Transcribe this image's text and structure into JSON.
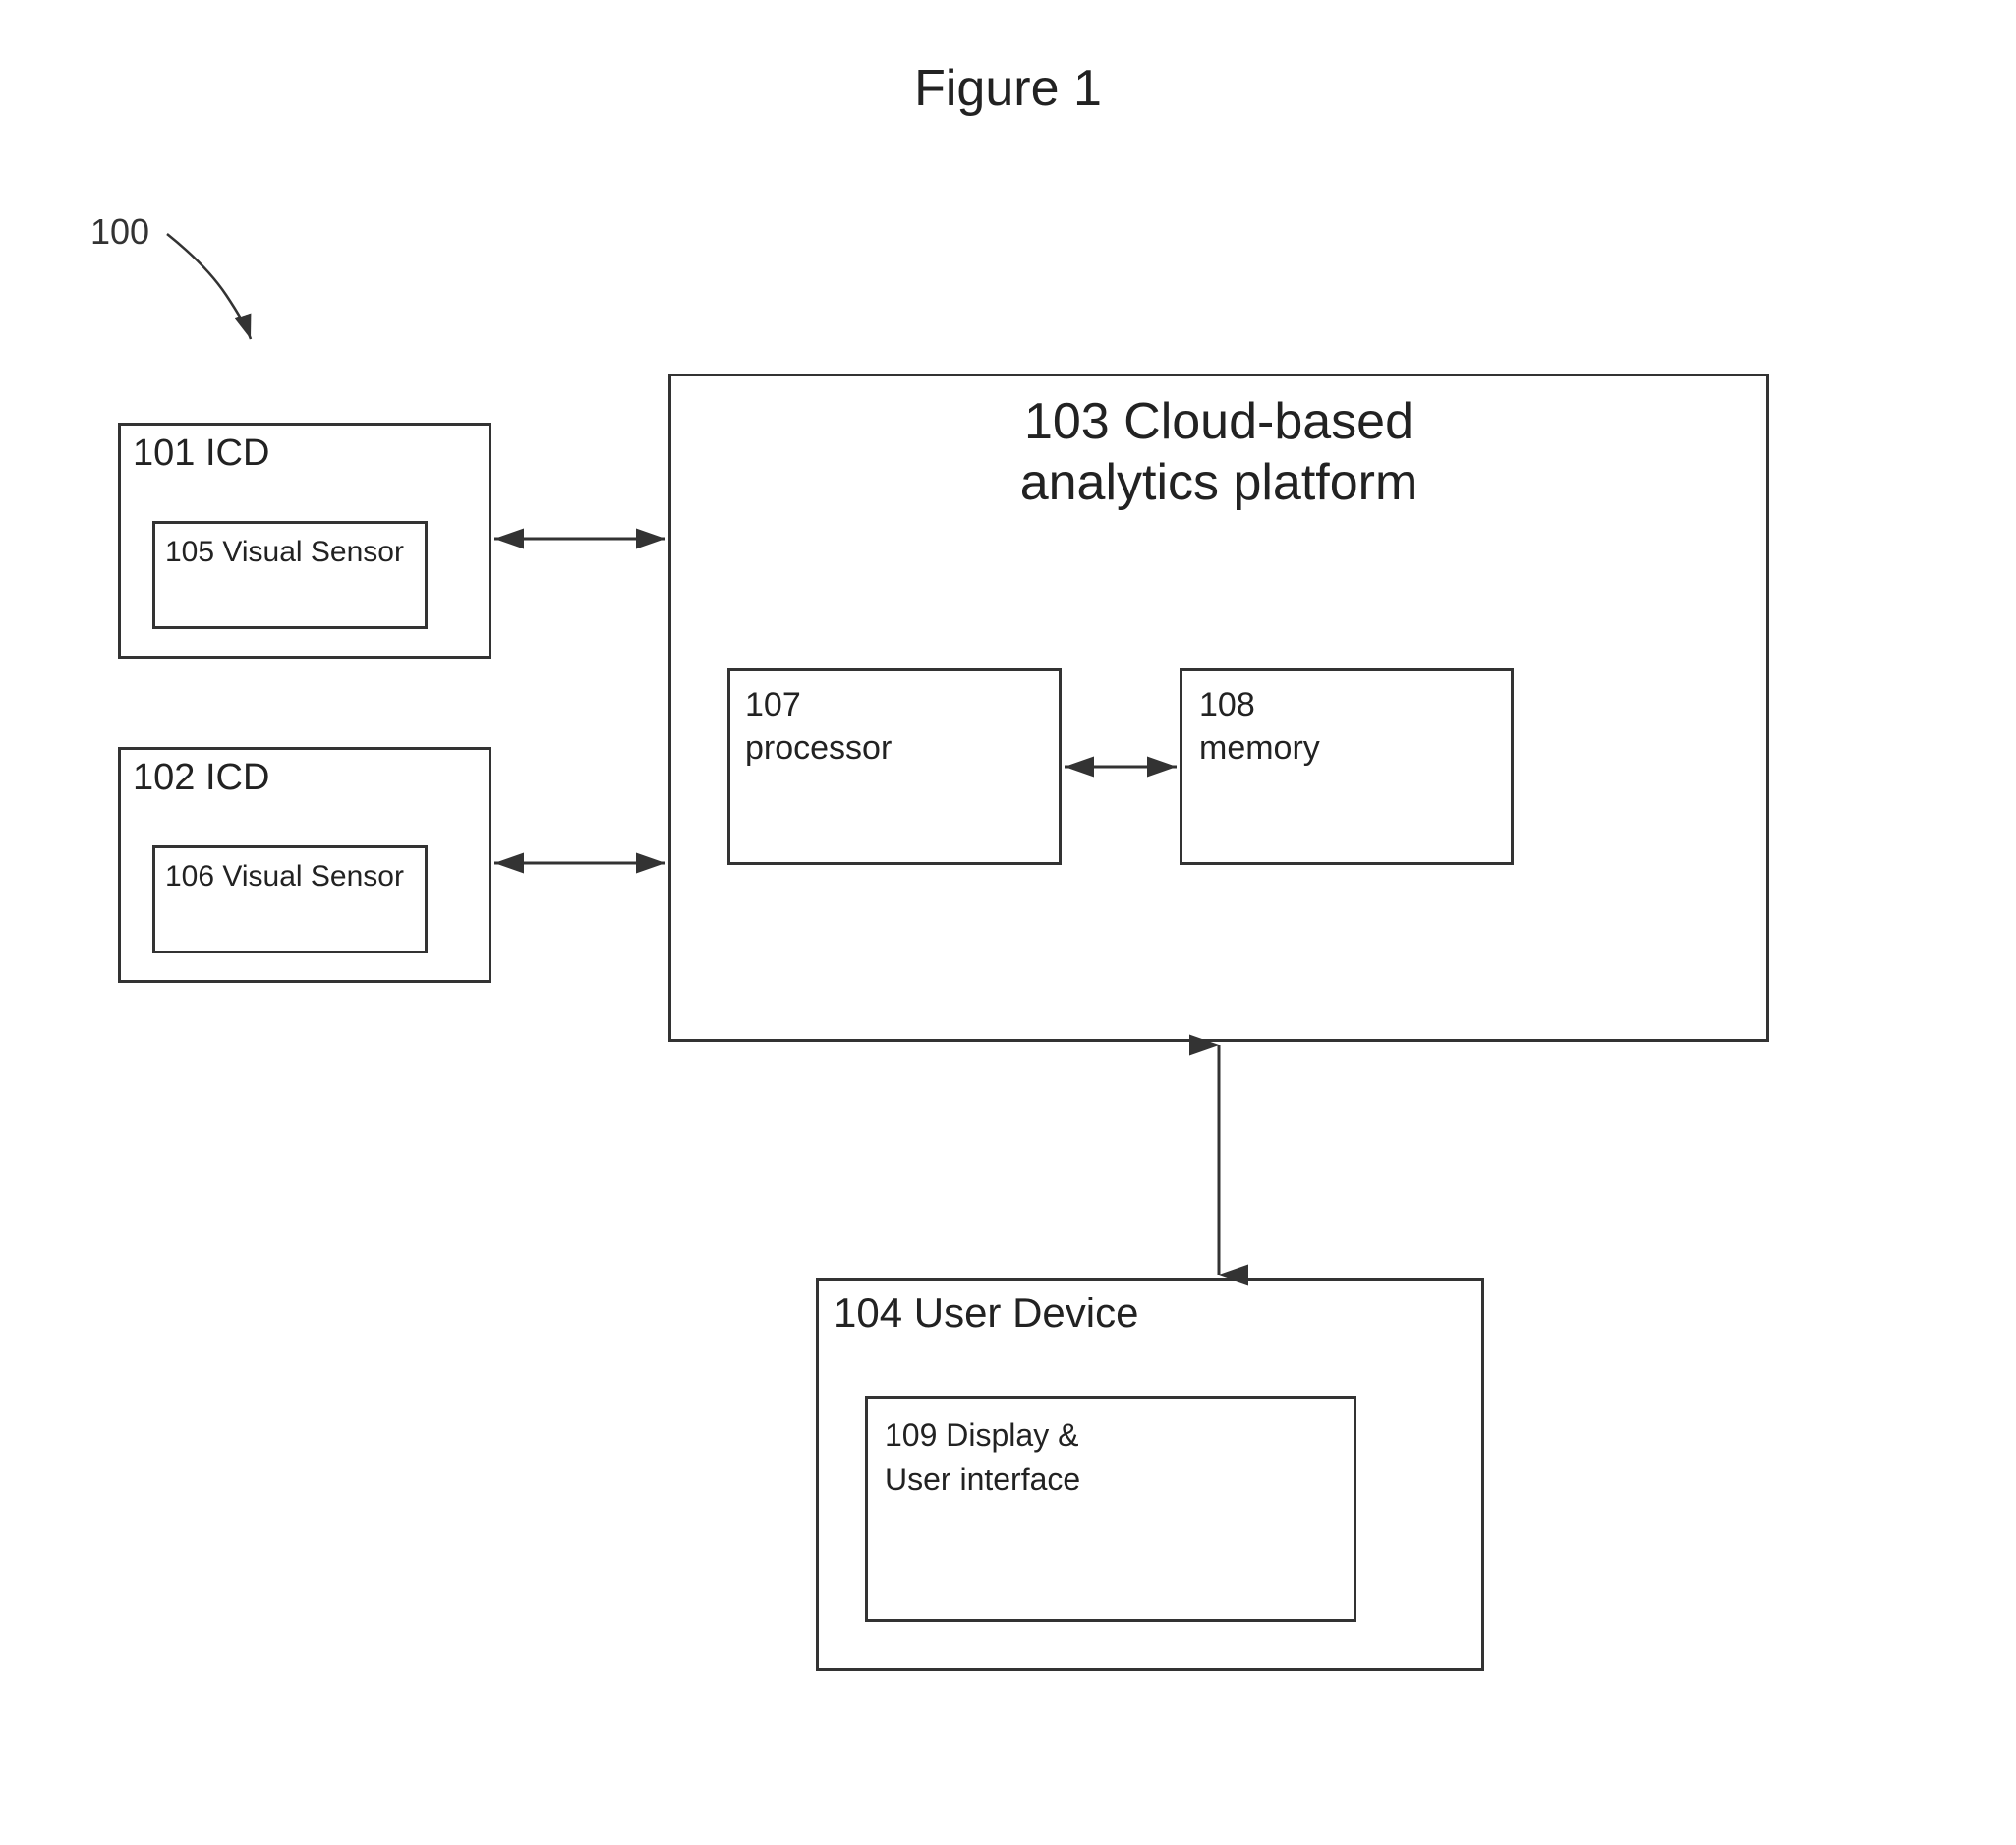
{
  "figure": {
    "title": "Figure 1"
  },
  "labels": {
    "ref_100": "100",
    "label_101": "101 ICD",
    "label_102": "102 ICD",
    "label_103": "103 Cloud-based\nanalytics platform",
    "label_104": "104 User Device",
    "label_105": "105 Visual Sensor",
    "label_106": "106 Visual Sensor",
    "label_107": "107\nprocessor",
    "label_108": "108\nmemory",
    "label_109": "109 Display &\nUser interface"
  }
}
